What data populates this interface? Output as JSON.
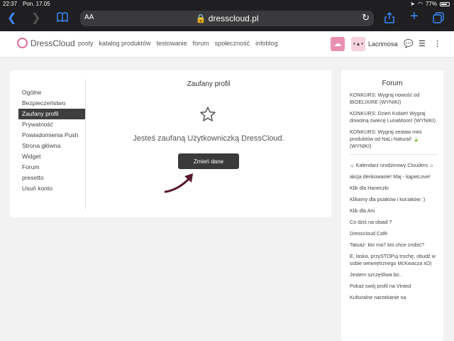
{
  "status_bar": {
    "time": "22:37",
    "date": "Pon. 17.05",
    "battery": "77%"
  },
  "browser": {
    "aa_label": "AA",
    "url": "dresscloud.pl"
  },
  "site": {
    "logo_text": "DressCloud",
    "nav": [
      "posty",
      "katalog produktów",
      "testowanie",
      "forum",
      "społeczność",
      "infoblog"
    ],
    "username": "Lacrimosa",
    "avatar2_text": "• ▴ •"
  },
  "settings": {
    "menu": [
      "Ogólne",
      "Bezpieczeństwo",
      "Zaufany profil",
      "Prywatność",
      "Powiadomienia Push",
      "Strona główna",
      "Widget",
      "Forum",
      "presetto",
      "Usuń konto"
    ],
    "active_index": 2,
    "title": "Zaufany profil",
    "message": "Jesteś zaufaną Użytkowniczką DressCloud.",
    "button_label": "Zmień dane"
  },
  "forum": {
    "title": "Forum",
    "top_posts": [
      "KONKURS: Wygraj nowość od BIOELIXIRE (WYNIKI)",
      "KONKURS: Dzień Kobiet! Wygraj dowolną świecę LunaMoon! (WYNIKI)",
      "KONKURS: Wygraj zestaw mini produktów od NaLi Natural! 🍃 (WYNIKI)"
    ],
    "threads": [
      "☼ Kalendarz urodzinowy Clouders ☼",
      "akcja denkowanie! Maj - kąpieLove!",
      "Klik dla Haneczki",
      "Klikamy dla psiaków i kociaków :)",
      "Klik dla Ani",
      "Co dziś na obiad ?",
      "Dresscloud Café",
      "Tatuaż- kto ma? kto chce zrobić?",
      "E, laska, przySTOPuj trochę, obudź w sobie wewnętrznego McKwacza xD)",
      "Jestem szczęśliwa bo..",
      "Pokaż swój profil na Vinted",
      "Kulturalne narzekanie na"
    ]
  }
}
